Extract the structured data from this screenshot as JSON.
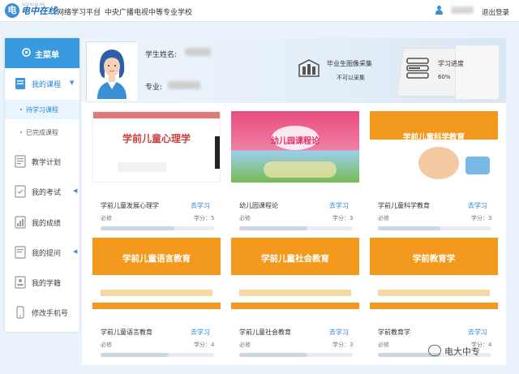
{
  "header": {
    "logo_text": "电中在线",
    "logo_sub": "DZZXONLINE",
    "platform": "网络学习平台",
    "school": "中央广播电视中等专业学校",
    "logout": "退出登录"
  },
  "sidebar": {
    "menu_title": "主菜单",
    "items": [
      {
        "label": "我的课程",
        "icon": "book-icon"
      },
      {
        "label": "教学计划",
        "icon": "plan-icon"
      },
      {
        "label": "我的考试",
        "icon": "exam-icon"
      },
      {
        "label": "我的成绩",
        "icon": "grade-icon"
      },
      {
        "label": "我的提问",
        "icon": "question-icon"
      },
      {
        "label": "我的学籍",
        "icon": "record-icon"
      },
      {
        "label": "修改手机号",
        "icon": "phone-icon"
      }
    ],
    "sub_items": [
      "待学习课程",
      "已完成课程"
    ]
  },
  "profile": {
    "name_label": "学生姓名:",
    "major_label": "专业:",
    "photo_title": "毕业生图像采集",
    "photo_status": "不可以采集",
    "progress_title": "学习进度",
    "progress_value": "60%"
  },
  "courses": [
    {
      "name": "学前儿童发展心理学",
      "action": "去学习",
      "type": "必修",
      "credit": "学分：5",
      "cover_title": "学前儿童心理学",
      "progress": 0.65
    },
    {
      "name": "幼儿园课程论",
      "action": "去学习",
      "type": "必修",
      "credit": "学分：3",
      "cover_title": "幼儿园课程论",
      "progress": 0.6
    },
    {
      "name": "学前儿童科学教育",
      "action": "去学习",
      "type": "必修",
      "credit": "学分：3",
      "cover_title": "学前儿童科学教育",
      "progress": 0.55
    },
    {
      "name": "学前儿童语言教育",
      "action": "去学习",
      "type": "必修",
      "credit": "学分：4",
      "cover_title": "学前儿童语言教育",
      "progress": 0.6
    },
    {
      "name": "学前儿童社会教育",
      "action": "去学习",
      "type": "必修",
      "credit": "学分：3",
      "cover_title": "学前儿童社会教育",
      "progress": 0.6
    },
    {
      "name": "学前教育学",
      "action": "去学习",
      "type": "必修",
      "credit": "学分：4",
      "cover_title": "学前教育学",
      "progress": 0.55
    }
  ],
  "watermark": "电大中专",
  "colors": {
    "accent": "#3a9ae0",
    "link": "#2a86d6",
    "cover_orange": "#f39a1e"
  }
}
